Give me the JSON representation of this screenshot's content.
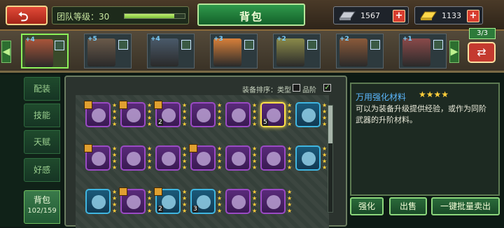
{
  "header": {
    "back_icon": "back-arrow-icon",
    "team_level_label": "团队等级：30",
    "team_xp_fraction": 0.82,
    "title": "背包",
    "silver_icon": "silver-bar-icon",
    "silver_value": "1567",
    "gold_icon": "gold-bar-icon",
    "gold_value": "1133"
  },
  "heroes": [
    {
      "stars": "+4",
      "portrait_color": "#a8553a",
      "selected": true
    },
    {
      "stars": "+5",
      "portrait_color": "#6a5a4a",
      "selected": false
    },
    {
      "stars": "+4",
      "portrait_color": "#4a5a6a",
      "selected": false
    },
    {
      "stars": "+3",
      "portrait_color": "#d8803a",
      "selected": false
    },
    {
      "stars": "+2",
      "portrait_color": "#8a8a4a",
      "selected": false
    },
    {
      "stars": "+2",
      "portrait_color": "#8a5a3a",
      "selected": false
    },
    {
      "stars": "+1",
      "portrait_color": "#8a4a4a",
      "selected": false
    }
  ],
  "slot_count": "3/3",
  "nav": {
    "tabs": [
      "配装",
      "技能",
      "天赋",
      "好感"
    ],
    "active_label": "背包",
    "bag_count": "102/159"
  },
  "sort": {
    "label": "装备排序：类型",
    "grade_label": "品阶",
    "grade_checked": "✓"
  },
  "items": [
    {
      "color": "purple",
      "lock": true,
      "stars": 4,
      "num": ""
    },
    {
      "color": "purple",
      "lock": true,
      "stars": 4,
      "num": ""
    },
    {
      "color": "purple",
      "lock": true,
      "stars": 4,
      "num": "2"
    },
    {
      "color": "purple",
      "lock": false,
      "stars": 4,
      "num": ""
    },
    {
      "color": "purple",
      "lock": false,
      "stars": 4,
      "num": ""
    },
    {
      "color": "purple",
      "lock": false,
      "stars": 4,
      "num": "5",
      "gold": true
    },
    {
      "color": "blue",
      "lock": false,
      "stars": 4,
      "num": ""
    },
    {
      "color": "purple",
      "lock": true,
      "stars": 4,
      "num": ""
    },
    {
      "color": "purple",
      "lock": false,
      "stars": 4,
      "num": ""
    },
    {
      "color": "purple",
      "lock": false,
      "stars": 4,
      "num": ""
    },
    {
      "color": "purple",
      "lock": true,
      "stars": 4,
      "num": ""
    },
    {
      "color": "purple",
      "lock": false,
      "stars": 4,
      "num": ""
    },
    {
      "color": "purple",
      "lock": false,
      "stars": 4,
      "num": ""
    },
    {
      "color": "blue",
      "lock": false,
      "stars": 4,
      "num": ""
    },
    {
      "color": "blue",
      "lock": false,
      "stars": 4,
      "num": ""
    },
    {
      "color": "purple",
      "lock": true,
      "stars": 4,
      "num": ""
    },
    {
      "color": "blue",
      "lock": true,
      "stars": 4,
      "num": "2"
    },
    {
      "color": "blue",
      "lock": false,
      "stars": 4,
      "num": "3"
    },
    {
      "color": "purple",
      "lock": false,
      "stars": 4,
      "num": ""
    },
    {
      "color": "purple",
      "lock": false,
      "stars": 4,
      "num": ""
    }
  ],
  "detail": {
    "name": "万用强化材料",
    "stars": "★★★★",
    "description": "可以为装备升级提供经验，或作为同阶武器的升阶材料。"
  },
  "buttons": {
    "enhance": "强化",
    "sell": "出售",
    "bulk_sell": "一键批量卖出"
  }
}
